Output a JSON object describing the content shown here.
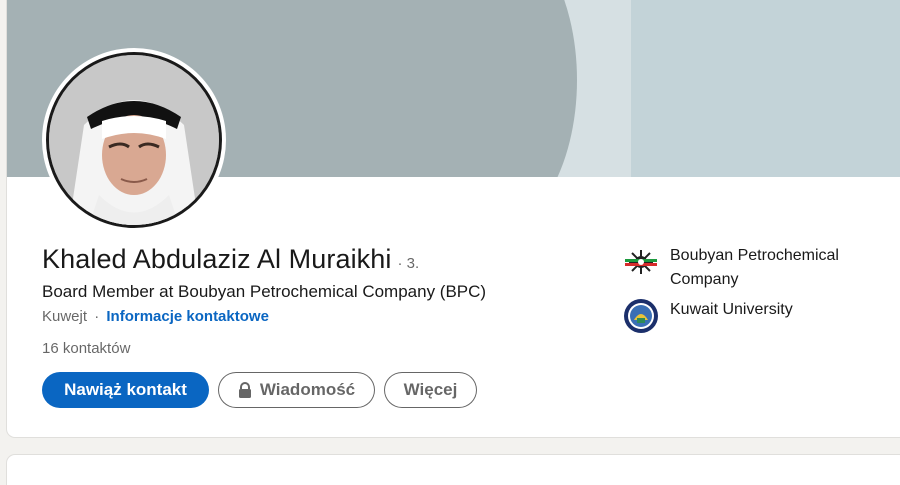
{
  "profile": {
    "name": "Khaled Abdulaziz Al Muraikhi",
    "degree": "· 3.",
    "headline": "Board Member at Boubyan Petrochemical Company (BPC)",
    "location": "Kuwejt",
    "separator": "·",
    "contact_info_link": "Informacje kontaktowe",
    "connections_count": "16",
    "connections_label": "kontaktów"
  },
  "actions": {
    "connect_label": "Nawiąż kontakt",
    "message_label": "Wiadomość",
    "more_label": "Więcej"
  },
  "organizations": [
    {
      "name": "Boubyan Petrochemical Company",
      "logo": "boubyan-logo"
    },
    {
      "name": "Kuwait University",
      "logo": "kuwait-university-logo"
    }
  ],
  "colors": {
    "primary": "#0a66c2",
    "cover": "#a4b1b4",
    "background": "#f3f2ef"
  }
}
